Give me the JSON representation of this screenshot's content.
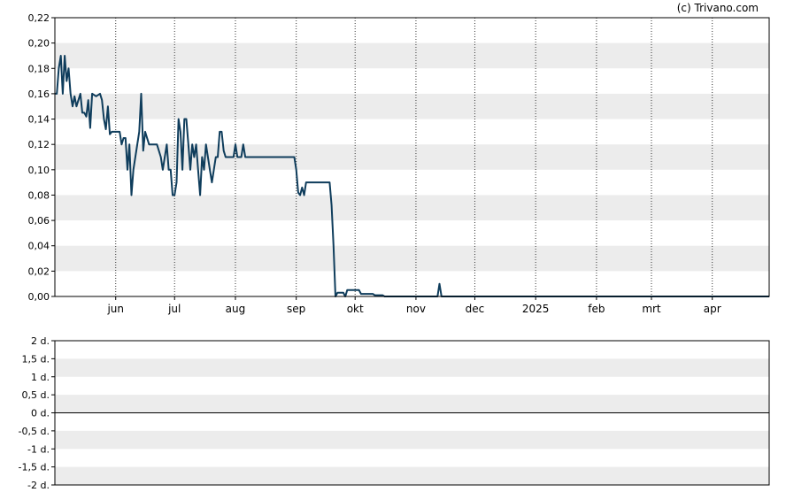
{
  "copyright": "(c) Trivano.com",
  "chart_data": [
    {
      "type": "line",
      "ylim": [
        0,
        0.22
      ],
      "y_ticks": [
        {
          "value": 0.0,
          "label": "0,00"
        },
        {
          "value": 0.02,
          "label": "0,02"
        },
        {
          "value": 0.04,
          "label": "0,04"
        },
        {
          "value": 0.06,
          "label": "0,06"
        },
        {
          "value": 0.08,
          "label": "0,08"
        },
        {
          "value": 0.1,
          "label": "0,10"
        },
        {
          "value": 0.12,
          "label": "0,12"
        },
        {
          "value": 0.14,
          "label": "0,14"
        },
        {
          "value": 0.16,
          "label": "0,16"
        },
        {
          "value": 0.18,
          "label": "0,18"
        },
        {
          "value": 0.2,
          "label": "0,20"
        },
        {
          "value": 0.22,
          "label": "0,22"
        }
      ],
      "x_range": [
        "2024-05-01",
        "2025-04-30"
      ],
      "x_ticks": [
        {
          "date": "2024-06-01",
          "label": "jun"
        },
        {
          "date": "2024-07-01",
          "label": "jul"
        },
        {
          "date": "2024-08-01",
          "label": "aug"
        },
        {
          "date": "2024-09-01",
          "label": "sep"
        },
        {
          "date": "2024-10-01",
          "label": "okt"
        },
        {
          "date": "2024-11-01",
          "label": "nov"
        },
        {
          "date": "2024-12-01",
          "label": "dec"
        },
        {
          "date": "2025-01-01",
          "label": "2025"
        },
        {
          "date": "2025-02-01",
          "label": "feb"
        },
        {
          "date": "2025-03-01",
          "label": "mrt"
        },
        {
          "date": "2025-04-01",
          "label": "apr"
        }
      ],
      "grid": "alternating horizontal bands, dotted vertical lines at month starts",
      "line_color": "#0f3d5c",
      "series": [
        {
          "points": [
            [
              "2024-05-01",
              0.16
            ],
            [
              "2024-05-02",
              0.16
            ],
            [
              "2024-05-03",
              0.18
            ],
            [
              "2024-05-04",
              0.19
            ],
            [
              "2024-05-05",
              0.16
            ],
            [
              "2024-05-06",
              0.19
            ],
            [
              "2024-05-07",
              0.17
            ],
            [
              "2024-05-08",
              0.18
            ],
            [
              "2024-05-09",
              0.16
            ],
            [
              "2024-05-10",
              0.15
            ],
            [
              "2024-05-11",
              0.158
            ],
            [
              "2024-05-12",
              0.15
            ],
            [
              "2024-05-14",
              0.16
            ],
            [
              "2024-05-15",
              0.145
            ],
            [
              "2024-05-16",
              0.145
            ],
            [
              "2024-05-17",
              0.142
            ],
            [
              "2024-05-18",
              0.155
            ],
            [
              "2024-05-19",
              0.133
            ],
            [
              "2024-05-20",
              0.16
            ],
            [
              "2024-05-22",
              0.158
            ],
            [
              "2024-05-24",
              0.16
            ],
            [
              "2024-05-25",
              0.155
            ],
            [
              "2024-05-26",
              0.14
            ],
            [
              "2024-05-27",
              0.132
            ],
            [
              "2024-05-28",
              0.15
            ],
            [
              "2024-05-29",
              0.128
            ],
            [
              "2024-05-30",
              0.13
            ],
            [
              "2024-06-03",
              0.13
            ],
            [
              "2024-06-04",
              0.12
            ],
            [
              "2024-06-05",
              0.125
            ],
            [
              "2024-06-06",
              0.125
            ],
            [
              "2024-06-07",
              0.1
            ],
            [
              "2024-06-08",
              0.12
            ],
            [
              "2024-06-09",
              0.08
            ],
            [
              "2024-06-10",
              0.1
            ],
            [
              "2024-06-12",
              0.12
            ],
            [
              "2024-06-13",
              0.13
            ],
            [
              "2024-06-14",
              0.16
            ],
            [
              "2024-06-15",
              0.115
            ],
            [
              "2024-06-16",
              0.13
            ],
            [
              "2024-06-18",
              0.12
            ],
            [
              "2024-06-22",
              0.12
            ],
            [
              "2024-06-24",
              0.11
            ],
            [
              "2024-06-25",
              0.1
            ],
            [
              "2024-06-27",
              0.12
            ],
            [
              "2024-06-28",
              0.1
            ],
            [
              "2024-06-29",
              0.1
            ],
            [
              "2024-06-30",
              0.08
            ],
            [
              "2024-07-01",
              0.08
            ],
            [
              "2024-07-02",
              0.09
            ],
            [
              "2024-07-03",
              0.14
            ],
            [
              "2024-07-04",
              0.13
            ],
            [
              "2024-07-05",
              0.1
            ],
            [
              "2024-07-06",
              0.14
            ],
            [
              "2024-07-07",
              0.14
            ],
            [
              "2024-07-08",
              0.12
            ],
            [
              "2024-07-09",
              0.1
            ],
            [
              "2024-07-10",
              0.12
            ],
            [
              "2024-07-11",
              0.11
            ],
            [
              "2024-07-12",
              0.12
            ],
            [
              "2024-07-13",
              0.1
            ],
            [
              "2024-07-14",
              0.08
            ],
            [
              "2024-07-15",
              0.11
            ],
            [
              "2024-07-16",
              0.1
            ],
            [
              "2024-07-17",
              0.12
            ],
            [
              "2024-07-19",
              0.1
            ],
            [
              "2024-07-20",
              0.09
            ],
            [
              "2024-07-21",
              0.1
            ],
            [
              "2024-07-22",
              0.11
            ],
            [
              "2024-07-23",
              0.11
            ],
            [
              "2024-07-24",
              0.13
            ],
            [
              "2024-07-25",
              0.13
            ],
            [
              "2024-07-26",
              0.115
            ],
            [
              "2024-07-27",
              0.11
            ],
            [
              "2024-07-31",
              0.11
            ],
            [
              "2024-08-01",
              0.12
            ],
            [
              "2024-08-02",
              0.11
            ],
            [
              "2024-08-04",
              0.11
            ],
            [
              "2024-08-05",
              0.12
            ],
            [
              "2024-08-06",
              0.11
            ],
            [
              "2024-08-31",
              0.11
            ],
            [
              "2024-09-01",
              0.1
            ],
            [
              "2024-09-02",
              0.082
            ],
            [
              "2024-09-03",
              0.08
            ],
            [
              "2024-09-04",
              0.086
            ],
            [
              "2024-09-05",
              0.08
            ],
            [
              "2024-09-06",
              0.09
            ],
            [
              "2024-09-18",
              0.09
            ],
            [
              "2024-09-19",
              0.072
            ],
            [
              "2024-09-20",
              0.04
            ],
            [
              "2024-09-21",
              0.0
            ],
            [
              "2024-09-22",
              0.003
            ],
            [
              "2024-09-25",
              0.003
            ],
            [
              "2024-09-26",
              0.0
            ],
            [
              "2024-09-27",
              0.005
            ],
            [
              "2024-10-03",
              0.005
            ],
            [
              "2024-10-04",
              0.002
            ],
            [
              "2024-10-10",
              0.002
            ],
            [
              "2024-10-11",
              0.001
            ],
            [
              "2024-10-15",
              0.001
            ],
            [
              "2024-10-16",
              0.0
            ],
            [
              "2024-11-12",
              0.0
            ],
            [
              "2024-11-13",
              0.01
            ],
            [
              "2024-11-14",
              0.0
            ],
            [
              "2025-04-30",
              0.0
            ]
          ]
        }
      ]
    },
    {
      "type": "line",
      "ylim": [
        -2,
        2
      ],
      "y_ticks": [
        {
          "value": 2,
          "label": "2 d."
        },
        {
          "value": 1.5,
          "label": "1,5 d."
        },
        {
          "value": 1,
          "label": "1 d."
        },
        {
          "value": 0.5,
          "label": "0,5 d."
        },
        {
          "value": 0,
          "label": "0 d."
        },
        {
          "value": -0.5,
          "label": "-0,5 d."
        },
        {
          "value": -1,
          "label": "-1 d."
        },
        {
          "value": -1.5,
          "label": "-1,5 d."
        },
        {
          "value": -2,
          "label": "-2 d."
        }
      ],
      "grid": "alternating horizontal bands",
      "series": []
    }
  ]
}
